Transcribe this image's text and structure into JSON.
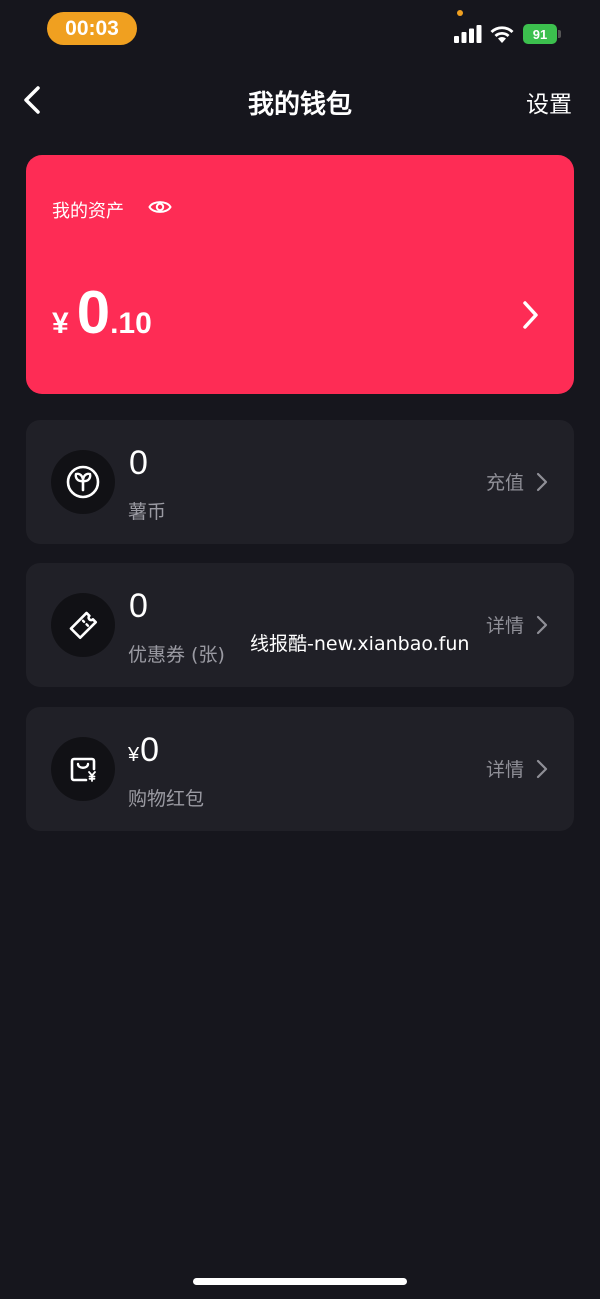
{
  "status_bar": {
    "time": "00:03",
    "battery": "91",
    "colors": {
      "time_pill": "#f0a020",
      "battery": "#3cc04e"
    }
  },
  "nav": {
    "title": "我的钱包",
    "settings_label": "设置"
  },
  "asset_card": {
    "label": "我的资产",
    "currency": "¥",
    "amount_int": "0",
    "amount_dec": ".10",
    "color": "#fe2c55"
  },
  "items": [
    {
      "value": "0",
      "currency": "",
      "label": "薯币",
      "action": "充值",
      "icon": "leaf-coin-icon"
    },
    {
      "value": "0",
      "currency": "",
      "label": "优惠券 (张)",
      "action": "详情",
      "icon": "coupon-icon"
    },
    {
      "value": "0",
      "currency": "¥",
      "label": "购物红包",
      "action": "详情",
      "icon": "shopping-bag-yen-icon"
    }
  ],
  "watermark": "线报酷-new.xianbao.fun"
}
